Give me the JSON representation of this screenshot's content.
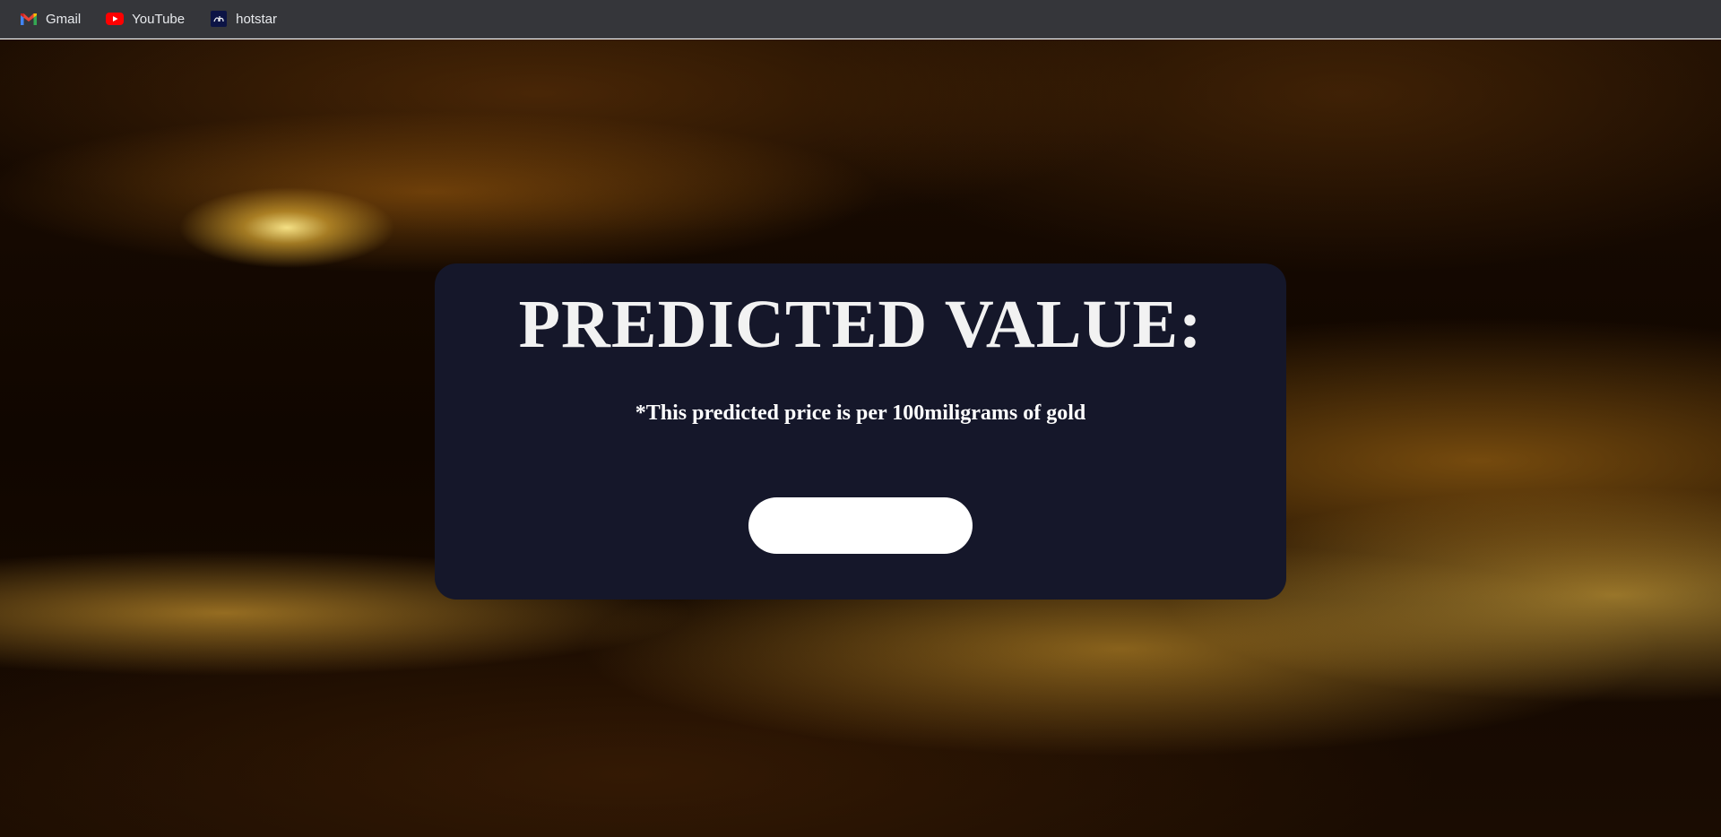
{
  "bookmarks": [
    {
      "label": "Gmail",
      "icon": "gmail-icon"
    },
    {
      "label": "YouTube",
      "icon": "youtube-icon"
    },
    {
      "label": "hotstar",
      "icon": "hotstar-icon"
    }
  ],
  "card": {
    "title": "PREDICTED VALUE:",
    "note": "*This predicted price is per 100miligrams of gold",
    "result_value": ""
  },
  "colors": {
    "bookmarks_bar": "#35363a",
    "card_background": "#15172a",
    "youtube_red": "#ff0000"
  }
}
